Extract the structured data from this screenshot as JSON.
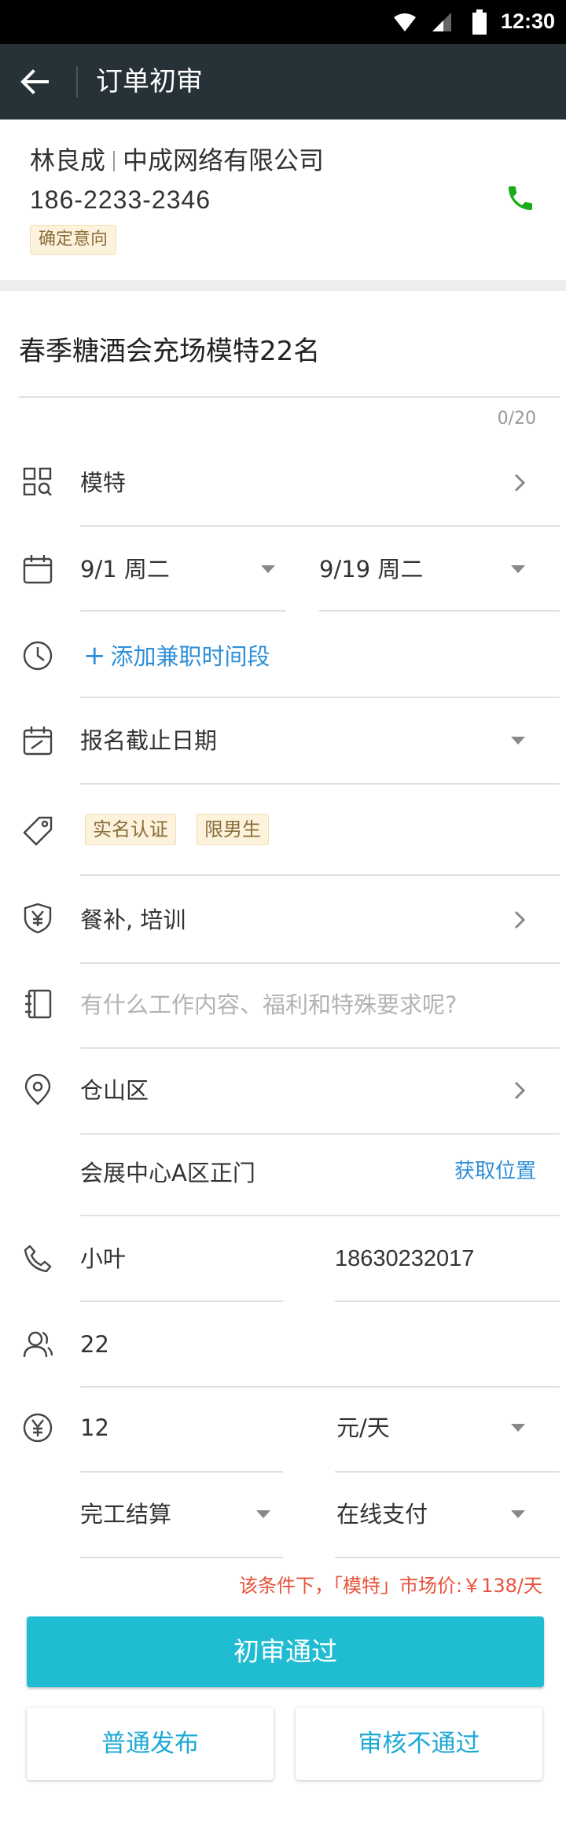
{
  "status_bar": {
    "time": "12:30"
  },
  "header": {
    "title": "订单初审"
  },
  "contact": {
    "name": "林良成",
    "company": "中成网络有限公司",
    "phone": "186-2233-2346",
    "tag": "确定意向"
  },
  "form": {
    "title": "春季糖酒会充场模特22名",
    "title_counter": "0/20",
    "category": "模特",
    "start_date": "9/1 周二",
    "end_date": "9/19 周二",
    "add_time_label": "添加兼职时间段",
    "deadline_label": "报名截止日期",
    "requirements": [
      "实名认证",
      "限男生"
    ],
    "benefits": "餐补, 培训",
    "description_placeholder": "有什么工作内容、福利和特殊要求呢?",
    "district": "仓山区",
    "address": "会展中心A区正门",
    "get_location_label": "获取位置",
    "contact_person": "小叶",
    "contact_phone": "18630232017",
    "headcount": "22",
    "salary": "12",
    "salary_unit": "元/天",
    "settlement": "完工结算",
    "payment": "在线支付"
  },
  "market_hint": "该条件下，「模特」市场价:￥138/天",
  "actions": {
    "approve": "初审通过",
    "normal_publish": "普通发布",
    "reject": "审核不通过"
  },
  "colors": {
    "primary": "#1fbcd2",
    "appbar": "#263238",
    "warning": "#e8523a",
    "link": "#2f8fd8",
    "call": "#1aad19"
  }
}
